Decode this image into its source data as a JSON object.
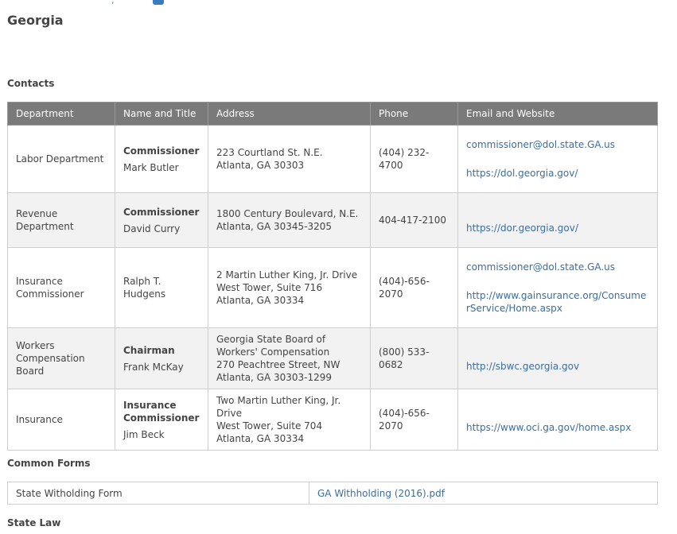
{
  "page": {
    "state_title": "Georgia"
  },
  "sections": {
    "contacts": "Contacts",
    "common_forms": "Common Forms",
    "state_law": "State Law"
  },
  "contacts_table": {
    "headers": [
      "Department",
      "Name and Title",
      "Address",
      "Phone",
      "Email and Website"
    ],
    "rows": [
      {
        "department": "Labor Department",
        "title": "Commissioner",
        "name": "Mark Butler",
        "address": [
          "223 Courtland St. N.E.",
          "Atlanta, GA 30303"
        ],
        "phone": "(404) 232-4700",
        "email": "commissioner@dol.state.GA.us",
        "website": "https://dol.georgia.gov/"
      },
      {
        "department": "Revenue Department",
        "title": "Commissioner",
        "name": "David Curry",
        "address": [
          "1800 Century Boulevard, N.E.",
          "Atlanta, GA 30345-3205"
        ],
        "phone": "404-417-2100",
        "email": "",
        "website": "https://dor.georgia.gov/"
      },
      {
        "department": "Insurance Commissioner",
        "title": "",
        "name": "Ralph T. Hudgens",
        "address": [
          "2 Martin Luther King, Jr. Drive",
          "West Tower, Suite 716",
          "Atlanta, GA 30334"
        ],
        "phone": "(404)-656-2070",
        "email": "commissioner@dol.state.GA.us",
        "website": "http://www.gainsurance.org/ConsumerService/Home.aspx"
      },
      {
        "department": "Workers Compensation Board",
        "title": "Chairman",
        "name": "Frank McKay",
        "address": [
          "Georgia State Board of Workers' Compensation",
          "270 Peachtree Street, NW",
          "Atlanta, GA 30303-1299"
        ],
        "phone": "(800) 533-0682",
        "email": "",
        "website": "http://sbwc.georgia.gov"
      },
      {
        "department": "Insurance",
        "title": "Insurance Commissioner",
        "name": "Jim Beck",
        "address": [
          "Two Martin Luther King, Jr. Drive",
          "West Tower, Suite 704",
          "Atlanta, GA 30334"
        ],
        "phone": "(404)-656-2070",
        "email": "",
        "website": "https://www.oci.ga.gov/home.aspx"
      }
    ]
  },
  "forms_table": {
    "rows": [
      {
        "name": "State Witholding Form",
        "file": "GA Withholding (2016).pdf"
      }
    ]
  },
  "colors": {
    "header_bg": "#7a7a7a",
    "link": "#3b6e9e",
    "alt_row": "#f2f2f2"
  }
}
